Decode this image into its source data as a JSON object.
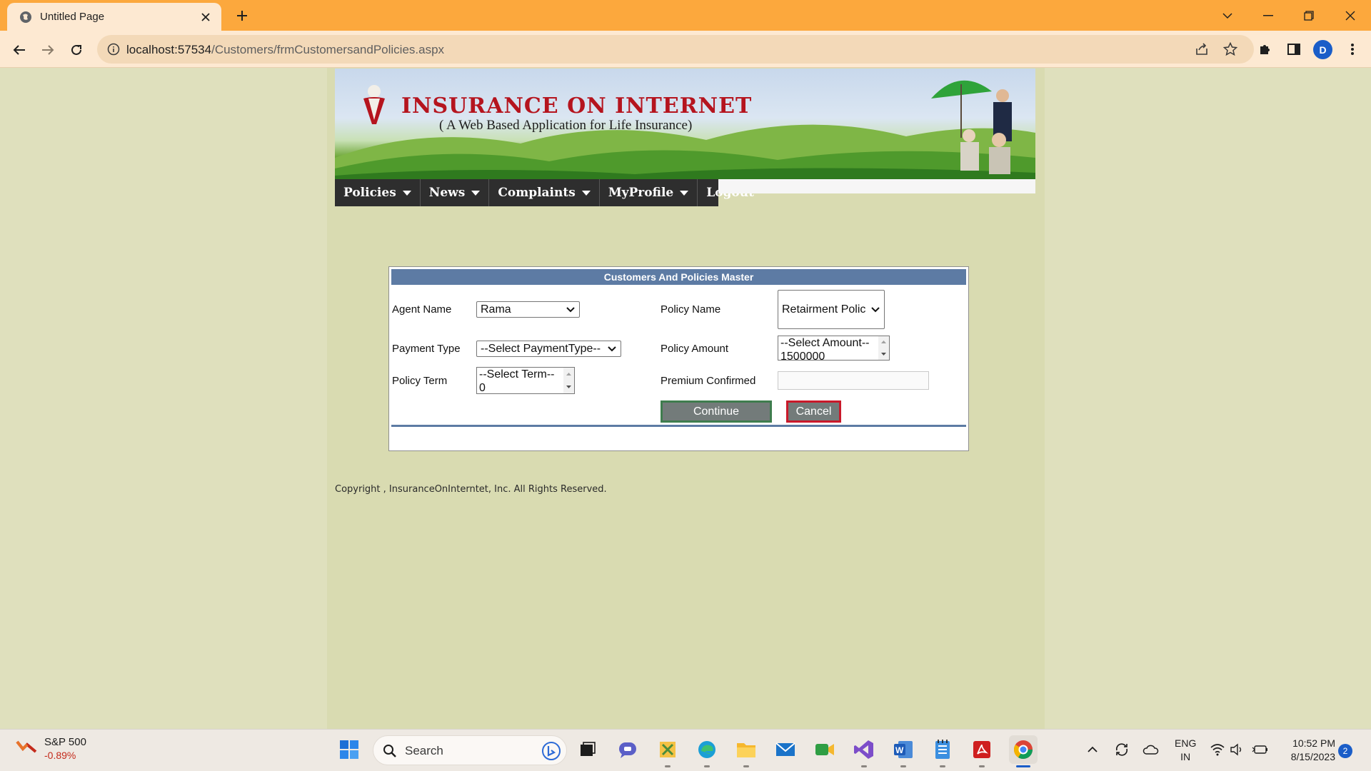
{
  "browser": {
    "tab_title": "Untitled Page",
    "url_host": "localhost:57534",
    "url_path": "/Customers/frmCustomersandPolicies.aspx",
    "profile_initial": "D"
  },
  "banner": {
    "title": "INSURANCE ON INTERNET",
    "subtitle": "( A Web Based Application for Life Insurance)"
  },
  "menu": {
    "items": [
      {
        "label": "Policies",
        "dropdown": true
      },
      {
        "label": "News",
        "dropdown": true
      },
      {
        "label": "Complaints",
        "dropdown": true
      },
      {
        "label": "MyProfile",
        "dropdown": true
      },
      {
        "label": "Logout",
        "dropdown": false
      }
    ]
  },
  "form": {
    "header": "Customers And Policies Master",
    "agent_name_label": "Agent Name",
    "agent_name_value": "Rama",
    "policy_name_label": "Policy Name",
    "policy_name_value": "Retairment Polic",
    "payment_type_label": "Payment Type",
    "payment_type_value": "--Select PaymentType--",
    "policy_amount_label": "Policy Amount",
    "policy_amount_options": [
      "--Select Amount--",
      "1500000"
    ],
    "policy_term_label": "Policy Term",
    "policy_term_options": [
      "--Select Term--",
      "0"
    ],
    "premium_confirmed_label": "Premium Confirmed",
    "premium_confirmed_value": "",
    "continue_label": "Continue",
    "cancel_label": "Cancel"
  },
  "footer": {
    "copyright": "Copyright , InsuranceOnInterntet, Inc. All Rights Reserved."
  },
  "taskbar": {
    "stock_name": "S&P 500",
    "stock_change": "-0.89%",
    "search_placeholder": "Search",
    "language": "ENG",
    "region": "IN",
    "time": "10:52 PM",
    "date": "8/15/2023",
    "notification_count": "2"
  },
  "colors": {
    "tabbar": "#fca83d",
    "toolbar": "#fde9d2",
    "page_bg": "#dfe0bd",
    "content_bg": "#d9dbb1",
    "menu_bg": "#2e2e2e",
    "panel_header": "#5d7ba4",
    "continue_border": "#3f7d4e",
    "cancel_border": "#c9192a",
    "brand_red": "#b5141e"
  }
}
